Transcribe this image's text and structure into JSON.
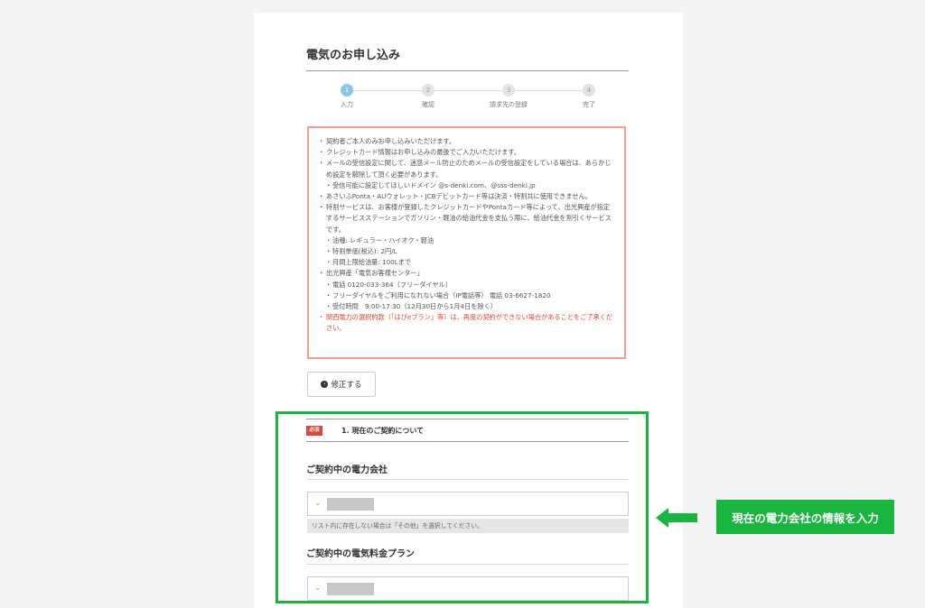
{
  "page": {
    "title": "電気のお申し込み"
  },
  "stepper": {
    "steps": [
      {
        "num": "1",
        "label": "入力"
      },
      {
        "num": "2",
        "label": "確認"
      },
      {
        "num": "3",
        "label": "請求先の登録"
      },
      {
        "num": "4",
        "label": "完了"
      }
    ],
    "active_step": "1"
  },
  "notice": {
    "lines": [
      "契約者ご本人のみお申し込みいただけます。",
      "クレジットカード情報はお申し込みの最後でご入力いただけます。",
      "メールの受信設定に関して、迷惑メール防止のためメールの受信設定をしている場合は、あらかじめ設定を解除して頂く必要があります。",
      "受信可能に設定してほしいドメイン @s-denki.com、@sss-denki.jp",
      "あさいふPonta・AUウォレット・JCBデビットカード等は決済・特割共に使用できません。",
      "特割サービスは、お客様が登録したクレジットカードやPontaカード等によって、出光興産が指定するサービスステーションでガソリン・軽油の給油代金を支払う際に、給油代金を割引くサービスです。",
      "油種: レギュラー・ハイオク・軽油",
      "特割単価(税込): 2円/L",
      "月間上限給油量: 100Lまで",
      "出光興産「電気お客様センター」",
      "電話 0120-033-364（フリーダイヤル）",
      "フリーダイヤルをご利用になれない場合（IP電話等） 電話 03-6627-1820",
      "受付時間　9:00-17:30（12月30日から1月4日を除く）",
      "関西電力の選択約款（「はぴeプラン」等）は、再度の契約ができない場合があることをご了承ください。"
    ]
  },
  "back_button": {
    "icon": "chevron-left-circle-icon",
    "label": "修正する"
  },
  "section": {
    "required_badge": "必須",
    "title": "1.  現在のご契約について"
  },
  "fields": {
    "power_company": {
      "label": "ご契約中の電力会社",
      "hint": "リスト内に存在しない場合は「その他」を選択してください。"
    },
    "rate_plan": {
      "label": "ご契約中の電気料金プラン"
    }
  },
  "callout": {
    "text": "現在の電力会社の情報を入力"
  },
  "colors": {
    "accent_green": "#19b540",
    "notice_border": "#f09f8d",
    "warn_red": "#e0463a",
    "chevron_orange": "#f1a21f",
    "step_active": "#8cc5ea"
  }
}
